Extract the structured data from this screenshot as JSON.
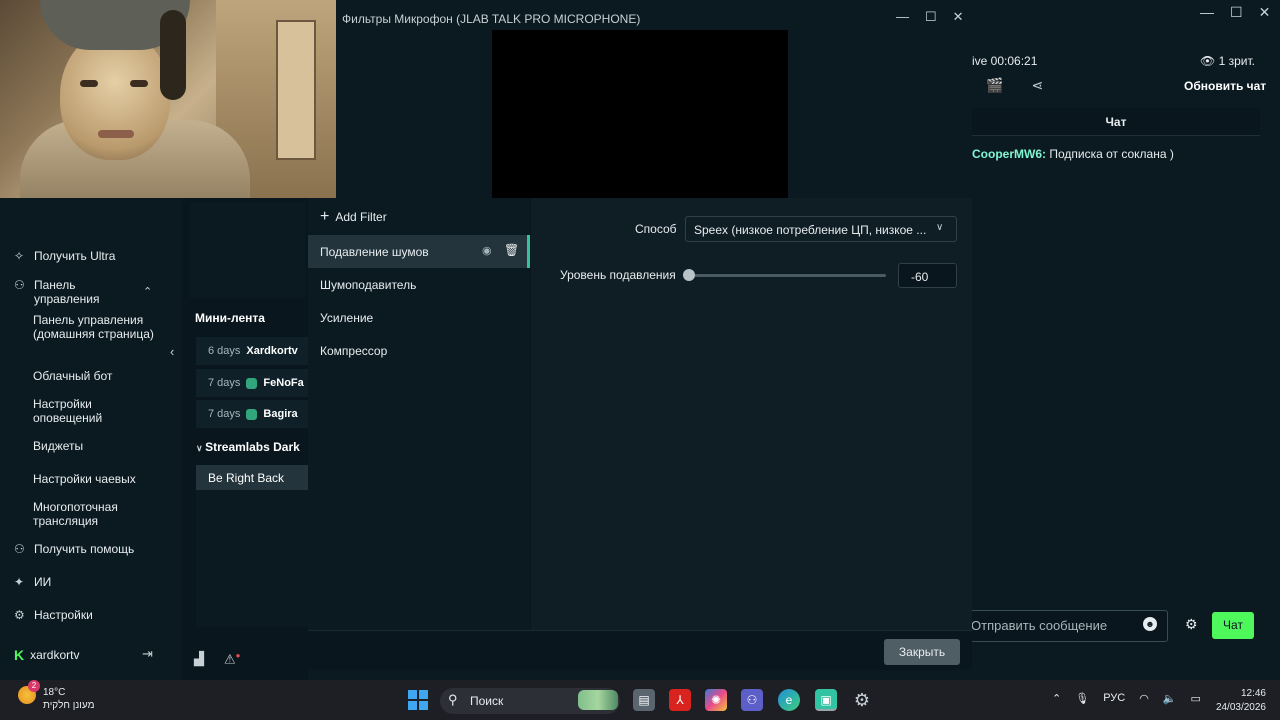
{
  "dialog": {
    "title": "Фильтры Микрофон (JLAB TALK PRO MICROPHONE)",
    "add_filter": "Add Filter",
    "filters": [
      {
        "label": "Подавление шумов",
        "active": true
      },
      {
        "label": "Шумоподавитель",
        "active": false
      },
      {
        "label": "Усиление",
        "active": false
      },
      {
        "label": "Компрессор",
        "active": false
      }
    ],
    "method_label": "Способ",
    "method_value": "Speex (низкое потребление ЦП, низкое ...",
    "level_label": "Уровень подавления",
    "level_value": "-60",
    "slider_fraction": 0.0,
    "close_label": "Закрыть"
  },
  "sidebar": {
    "ultra": "Получить Ultra",
    "dashboard": "Панель управления",
    "sub_items": [
      "Панель управления (домашняя страница)",
      "Облачный бот",
      "Настройки оповещений",
      "Виджеты",
      "Настройки чаевых",
      "Многопоточная трансляция"
    ],
    "help": "Получить помощь",
    "ai": "ИИ",
    "settings": "Настройки",
    "username": "xardkortv"
  },
  "mini_feed": {
    "title": "Мини-лента",
    "rows": [
      {
        "age": "6 days",
        "name": "Xardkortv",
        "badge": false
      },
      {
        "age": "7 days",
        "name": "FeNoFa",
        "badge": true
      },
      {
        "age": "7 days",
        "name": "Bagira",
        "badge": true
      }
    ]
  },
  "scenes": {
    "collection": "Streamlabs Dark",
    "item": "Be Right Back"
  },
  "chat": {
    "live_time": "ive 00:06:21",
    "viewers": "1 зрит.",
    "refresh": "Обновить чат",
    "tab": "Чат",
    "message_user": "CooperMW6:",
    "message_text": "Подписка от соклана )",
    "input_placeholder": "Отправить сообщение",
    "send_label": "Чат"
  },
  "taskbar": {
    "temperature": "18°C",
    "weather_desc": "מעונן חלקית",
    "weather_badge": "2",
    "search_placeholder": "Поиск",
    "language": "РУС",
    "time": "12:46",
    "date": "24/03/2026"
  },
  "colors": {
    "accent": "#31c3a2",
    "chat_send": "#4ef85b",
    "chat_user": "#80f5d2"
  }
}
